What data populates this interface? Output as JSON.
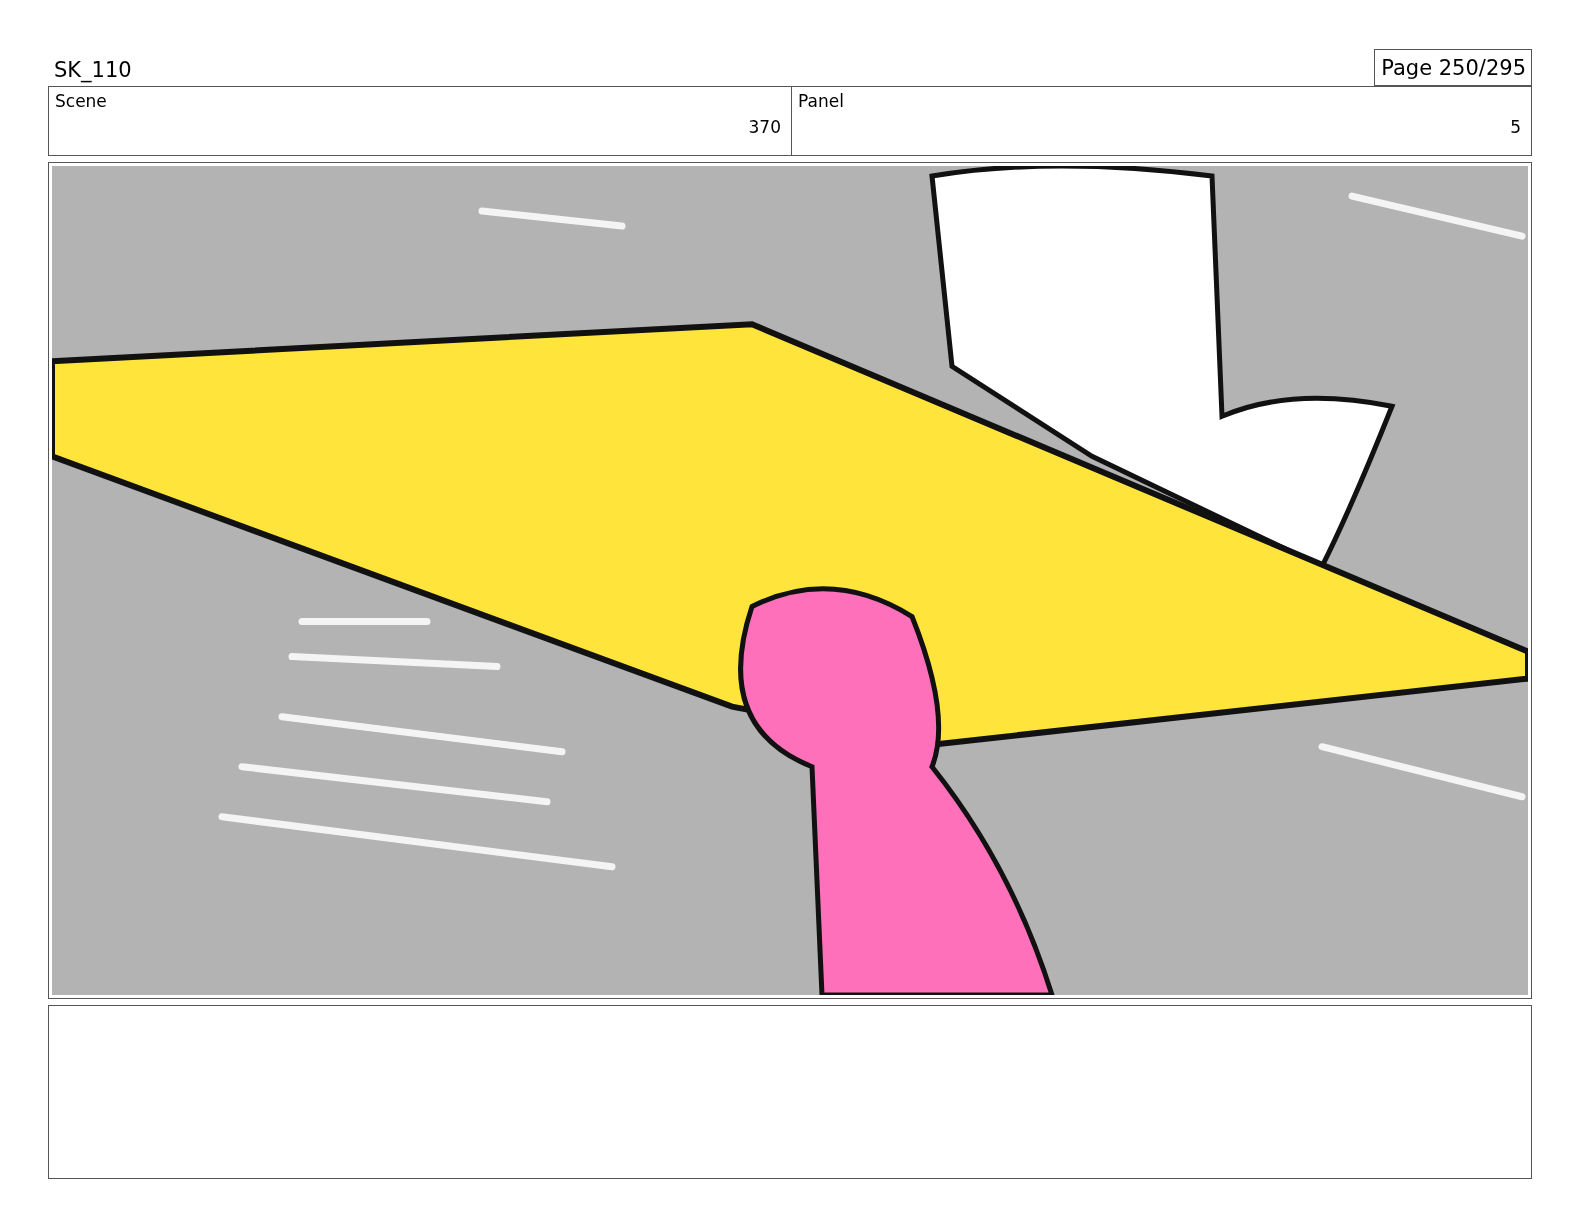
{
  "sheet": {
    "title": "SK_110",
    "page": "Page 250/295"
  },
  "header": [
    {
      "label": "Scene",
      "value": "370"
    },
    {
      "label": "Panel",
      "value": "5"
    }
  ]
}
